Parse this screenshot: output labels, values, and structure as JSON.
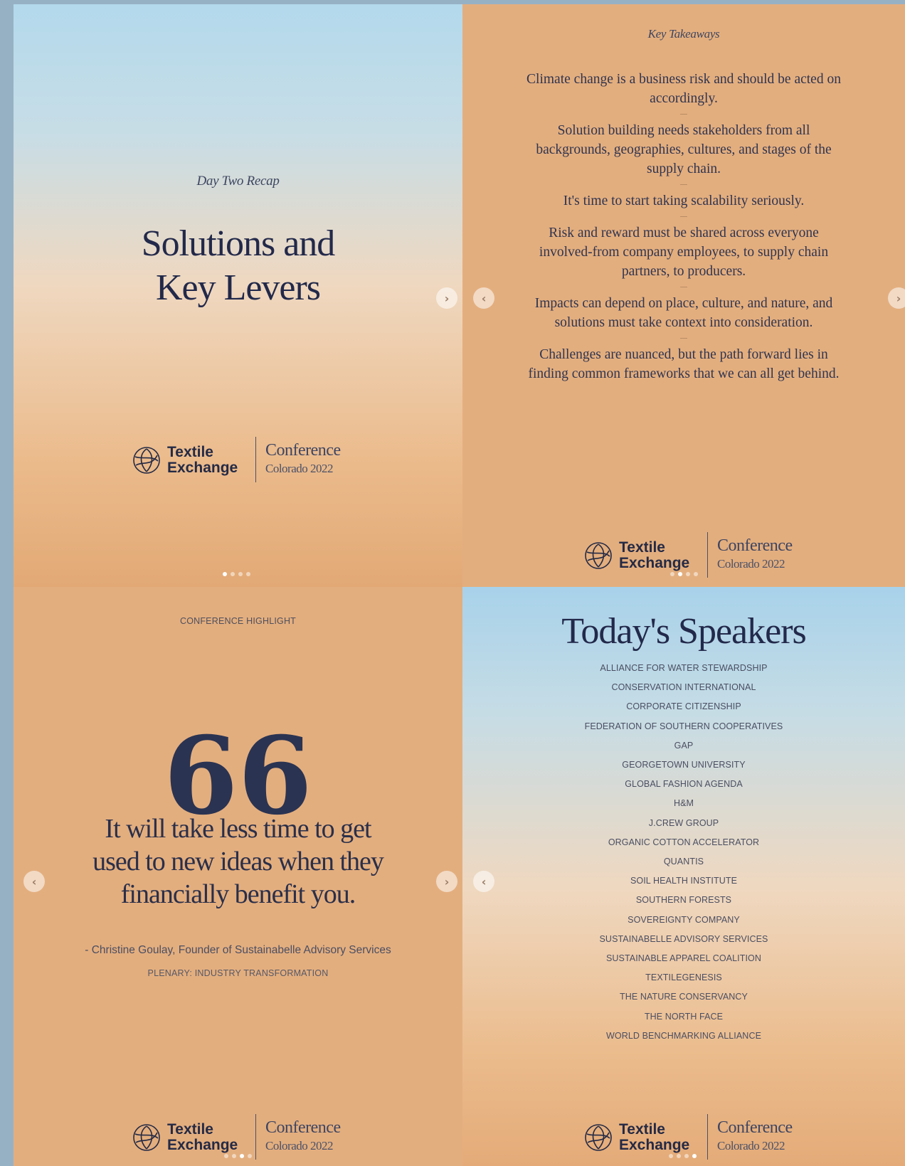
{
  "slide1": {
    "kicker": "Day Two Recap",
    "title_line1": "Solutions and",
    "title_line2": "Key Levers"
  },
  "slide2": {
    "heading": "Key Takeaways",
    "items": [
      "Climate change is a business risk and should be acted on accordingly.",
      "Solution building needs stakeholders from all backgrounds, geographies, cultures, and stages of the supply chain.",
      "It's time to start taking scalability seriously.",
      "Risk and reward must be shared across everyone involved-from company employees, to supply chain partners, to producers.",
      "Impacts can depend on place, culture, and nature, and solutions must take context into consideration.",
      "Challenges are nuanced, but the path forward lies in finding common frameworks that we can all get behind."
    ]
  },
  "slide3": {
    "tag": "CONFERENCE HIGHLIGHT",
    "quote_mark": "66",
    "quote_line1": "It will take less time to get",
    "quote_line2": "used to new ideas when they",
    "quote_line3": "financially benefit you.",
    "attribution": "- Christine Goulay, Founder of Sustainabelle Advisory Services",
    "session": "PLENARY: INDUSTRY TRANSFORMATION"
  },
  "slide4": {
    "title": "Today's Speakers",
    "speakers": [
      "ALLIANCE FOR WATER STEWARDSHIP",
      "CONSERVATION INTERNATIONAL",
      "CORPORATE CITIZENSHIP",
      "FEDERATION OF SOUTHERN COOPERATIVES",
      "GAP",
      "GEORGETOWN UNIVERSITY",
      "GLOBAL FASHION AGENDA",
      "H&M",
      "J.CREW GROUP",
      "ORGANIC COTTON ACCELERATOR",
      "QUANTIS",
      "SOIL HEALTH INSTITUTE",
      "SOUTHERN FORESTS",
      "SOVEREIGNTY COMPANY",
      "SUSTAINABELLE ADVISORY SERVICES",
      "SUSTAINABLE APPAREL COALITION",
      "TEXTILEGENESIS",
      "THE NATURE CONSERVANCY",
      "THE NORTH FACE",
      "WORLD BENCHMARKING ALLIANCE"
    ]
  },
  "logo": {
    "brand_line1": "Textile",
    "brand_line2": "Exchange",
    "conference": "Conference",
    "location": "Colorado 2022"
  },
  "icons": {
    "next": "chevron-right-icon",
    "prev": "chevron-left-icon",
    "logo_mark": "textile-exchange-logo-icon"
  },
  "carousel": {
    "slide_count": 4,
    "slide1_active_dot": 1,
    "slide2_active_dot": 2,
    "slide3_active_dot": 3,
    "slide4_active_dot": 4
  },
  "colors": {
    "page_bg": "#97b1c4",
    "peach": "#e3ae7e",
    "navy_text": "#22294a"
  }
}
